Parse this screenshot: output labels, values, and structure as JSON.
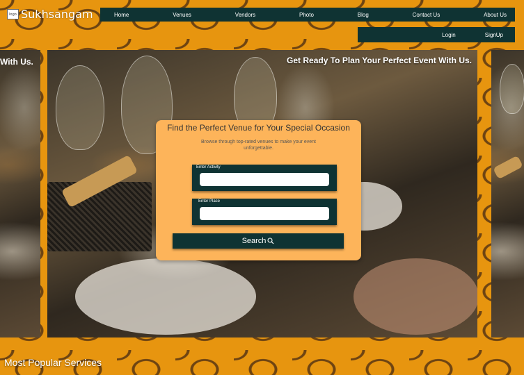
{
  "brand": {
    "name": "Sukhsangam",
    "logo_text": "logo"
  },
  "nav": {
    "items": [
      "Home",
      "Venues",
      "Vendors",
      "Photo",
      "Blog",
      "Contact Us",
      "About Us"
    ]
  },
  "auth": {
    "login": "Login",
    "signup": "SignUp"
  },
  "hero": {
    "tagline": "Get Ready To Plan Your Perfect Event With Us.",
    "side_left_text": "With Us."
  },
  "search_card": {
    "title": "Find the Perfect Venue for Your Special Occasion",
    "subtitle": "Browse through top-rated venues to make your event unforgettable.",
    "activity_label": "Enter Activity",
    "activity_value": "",
    "place_label": "Enter Place",
    "place_value": "",
    "search_label": "Search"
  },
  "sections": {
    "popular_title": "Most Popular Services"
  },
  "colors": {
    "pattern_bg": "#e7950f",
    "pattern_line": "#6e4412",
    "dark_teal": "#0f3333",
    "card_bg": "#fdb45a"
  },
  "icons": {
    "search": "search-icon"
  }
}
